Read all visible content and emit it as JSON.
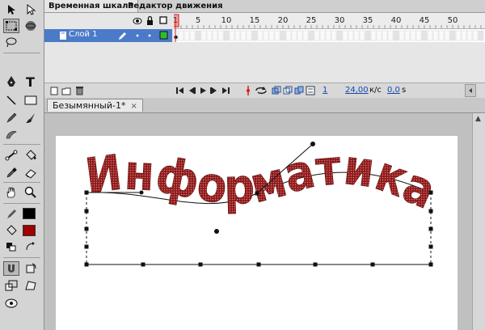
{
  "timeline": {
    "tabs": [
      "Временная шкала",
      "Редактор движения"
    ],
    "layer_name": "Слой 1",
    "frame_numbers": [
      "1",
      "5",
      "10",
      "15",
      "20",
      "25",
      "30",
      "35",
      "40",
      "45",
      "50"
    ],
    "fps": "24,00",
    "fps_unit": "к/с",
    "time": "0,0",
    "time_unit": "s",
    "current_frame": "1"
  },
  "document": {
    "tab_title": "Безымянный-1*",
    "close_glyph": "×"
  },
  "artwork": {
    "text": "Информатика",
    "fill_color": "#8e1a1a",
    "dot_color": "#d97a7a"
  },
  "tools": {
    "stroke_color": "#000000",
    "fill_color": "#a00000"
  },
  "icons": {
    "eye": "eye-icon",
    "lock": "lock-icon",
    "outline": "outline-square-icon",
    "pencil": "pencil-icon"
  }
}
